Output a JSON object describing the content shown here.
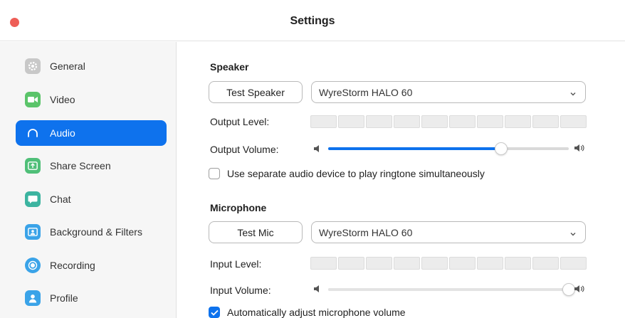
{
  "window": {
    "title": "Settings"
  },
  "colors": {
    "accent": "#0e72ed",
    "close_button": "#ee5e57"
  },
  "sidebar": {
    "items": [
      {
        "label": "General",
        "icon": "gear-icon",
        "icon_color": "#c8c8c8",
        "active": false
      },
      {
        "label": "Video",
        "icon": "video-camera-icon",
        "icon_color": "#5bc46a",
        "active": false
      },
      {
        "label": "Audio",
        "icon": "headphones-icon",
        "icon_color": "#0e72ed",
        "active": true
      },
      {
        "label": "Share Screen",
        "icon": "share-screen-icon",
        "icon_color": "#4fbf78",
        "active": false
      },
      {
        "label": "Chat",
        "icon": "chat-bubble-icon",
        "icon_color": "#3cb4a0",
        "active": false
      },
      {
        "label": "Background & Filters",
        "icon": "person-background-icon",
        "icon_color": "#3aa3e8",
        "active": false
      },
      {
        "label": "Recording",
        "icon": "record-icon",
        "icon_color": "#3aa3e8",
        "active": false
      },
      {
        "label": "Profile",
        "icon": "profile-icon",
        "icon_color": "#3aa3e8",
        "active": false
      }
    ]
  },
  "speaker": {
    "section_title": "Speaker",
    "test_button": "Test Speaker",
    "device": "WyreStorm HALO 60",
    "output_level_label": "Output Level:",
    "output_level": 0,
    "output_volume_label": "Output Volume:",
    "output_volume": 0.72,
    "separate_ringtone_label": "Use separate audio device to play ringtone simultaneously",
    "separate_ringtone_checked": false
  },
  "microphone": {
    "section_title": "Microphone",
    "test_button": "Test Mic",
    "device": "WyreStorm HALO 60",
    "input_level_label": "Input Level:",
    "input_level": 0,
    "input_volume_label": "Input Volume:",
    "input_volume": 1.0,
    "auto_adjust_label": "Automatically adjust microphone volume",
    "auto_adjust_checked": true
  }
}
